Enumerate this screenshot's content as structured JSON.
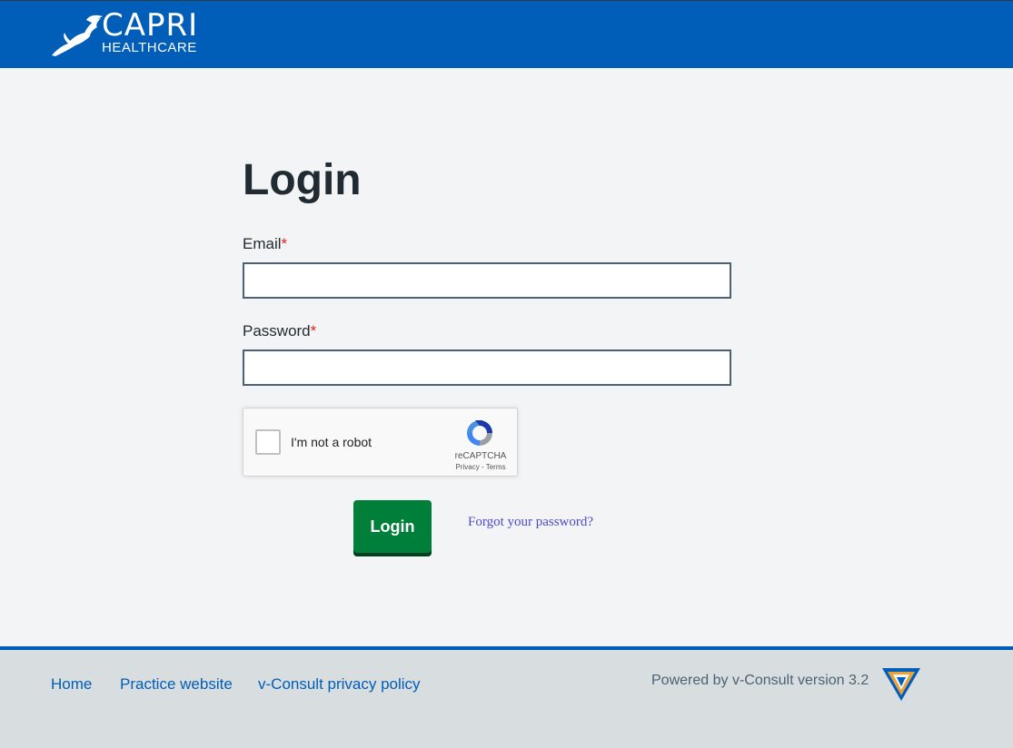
{
  "header": {
    "brand_title": "CAPRI",
    "brand_sub": "HEALTHCARE",
    "brand_color": "#005eb8"
  },
  "form": {
    "title": "Login",
    "email_label": "Email",
    "password_label": "Password",
    "required_marker": "*",
    "email_value": "",
    "password_value": "",
    "captcha_label": "I'm not a robot",
    "captcha_brand": "reCAPTCHA",
    "captcha_links": "Privacy - Terms",
    "login_button": "Login",
    "forgot_link": "Forgot your password?",
    "button_color": "#007f3b"
  },
  "footer": {
    "links": [
      "Home",
      "Practice website",
      "v-Consult privacy policy"
    ],
    "powered_by": "Powered by v-Consult version 3.2"
  },
  "icons": {
    "brand": "leaping-cat-logo-icon",
    "captcha": "recaptcha-icon",
    "vconsult": "v-consult-logo-icon"
  }
}
